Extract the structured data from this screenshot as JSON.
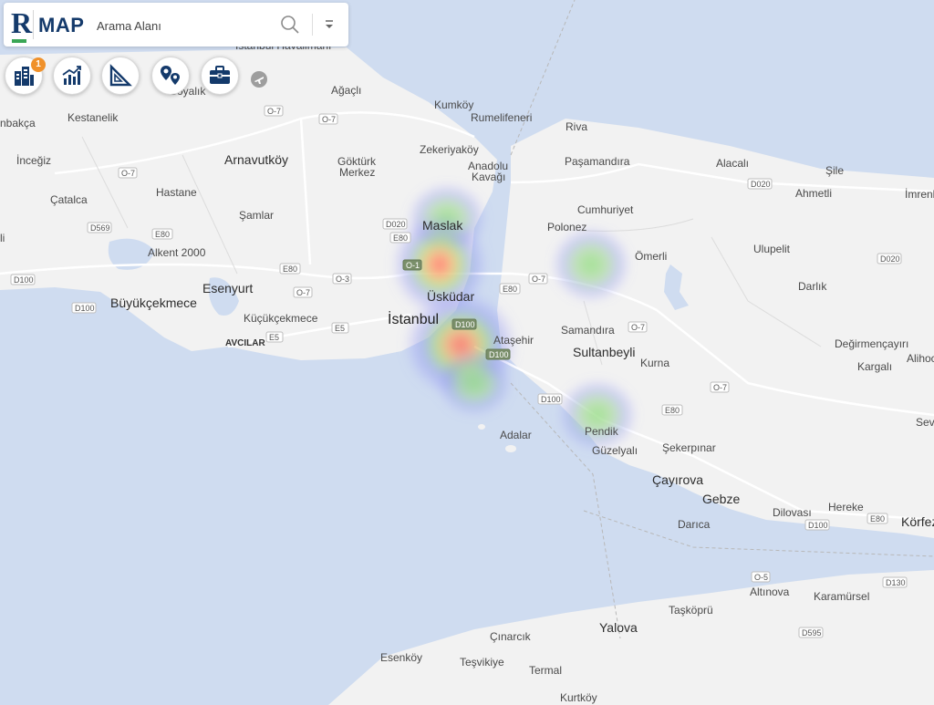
{
  "app": {
    "logo_letter": "R",
    "brand": "MAP"
  },
  "search": {
    "placeholder": "Arama Alanı"
  },
  "toolbar": {
    "items": [
      {
        "icon": "buildings-icon",
        "badge": "1"
      },
      {
        "icon": "chart-growth-icon"
      },
      {
        "icon": "set-square-icon"
      },
      {
        "icon": "location-pins-icon"
      },
      {
        "icon": "briefcase-icon"
      }
    ]
  },
  "map": {
    "labels": {
      "istanbul_havalimani": "İstanbul Havalimanı",
      "boyalik": "Boyalık",
      "agacli": "Ağaçlı",
      "kumkoy": "Kumköy",
      "rumelifeneri": "Rumelifeneri",
      "riva": "Riva",
      "binkilic": "nbakça",
      "kestanelik": "Kestanelik",
      "zekeriyakoy": "Zekeriyaköy",
      "pasamandira": "Paşamandıra",
      "alacali": "Alacalı",
      "sile": "Şile",
      "imrenli": "İmrenl",
      "inceguz": "İnceğiz",
      "arnavutkoy": "Arnavutköy",
      "gokturk": "Göktürk",
      "merkez": "Merkez",
      "anadolu": "Anadolu",
      "kavagi": "Kavağı",
      "ahmetli": "Ahmetli",
      "catalca": "Çatalca",
      "hastane": "Hastane",
      "samlar": "Şamlar",
      "maslak": "Maslak",
      "cumhuriyet": "Cumhuriyet",
      "polonez": "Polonez",
      "ulupelit": "Ulupelit",
      "alkent": "Alkent 2000",
      "omerli": "Ömerli",
      "esenyurt": "Esenyurt",
      "darlik": "Darlık",
      "buyukcekmece": "Büyükçekmece",
      "uskudar": "Üsküdar",
      "kucukcekmece": "Küçükçekmece",
      "istanbul": "İstanbul",
      "samandira": "Samandıra",
      "avcilar": "AVCILAR",
      "atasehir": "Ataşehir",
      "sultanbeyli": "Sultanbeyli",
      "degirmencayiri": "Değirmençayırı",
      "kargali": "Kargalı",
      "alihoca": "Alihoc",
      "kurna": "Kurna",
      "sev": "Sev",
      "pendik": "Pendik",
      "adalar": "Adalar",
      "guzelyali": "Güzelyalı",
      "sekerpinar": "Şekerpınar",
      "cayirova": "Çayırova",
      "gebze": "Gebze",
      "hereke": "Hereke",
      "darica": "Darıca",
      "dilovasi": "Dilovası",
      "korfez": "Körfez",
      "altinova": "Altınova",
      "karamursel": "Karamürsel",
      "taskopru": "Taşköprü",
      "yalova": "Yalova",
      "cinarcik": "Çınarcık",
      "esenkoy": "Esenköy",
      "tesvikiye": "Teşvikiye",
      "termal": "Termal",
      "kurtkoy": "Kurtköy",
      "liv": "li"
    },
    "shields": {
      "o7": "O-7",
      "o5": "O-5",
      "o3": "O-3",
      "o1": "O-1",
      "e80": "E80",
      "e5": "E5",
      "d020": "D020",
      "d100": "D100",
      "d569": "D569",
      "d130": "D130",
      "d595": "D595"
    },
    "colors": {
      "land": "#f2f2f2",
      "water": "#cfdcf0",
      "road": "#ffffff",
      "heat_low": "#7b7cf0",
      "heat_mid": "#9ee07a",
      "heat_high": "#f06a6a"
    }
  }
}
